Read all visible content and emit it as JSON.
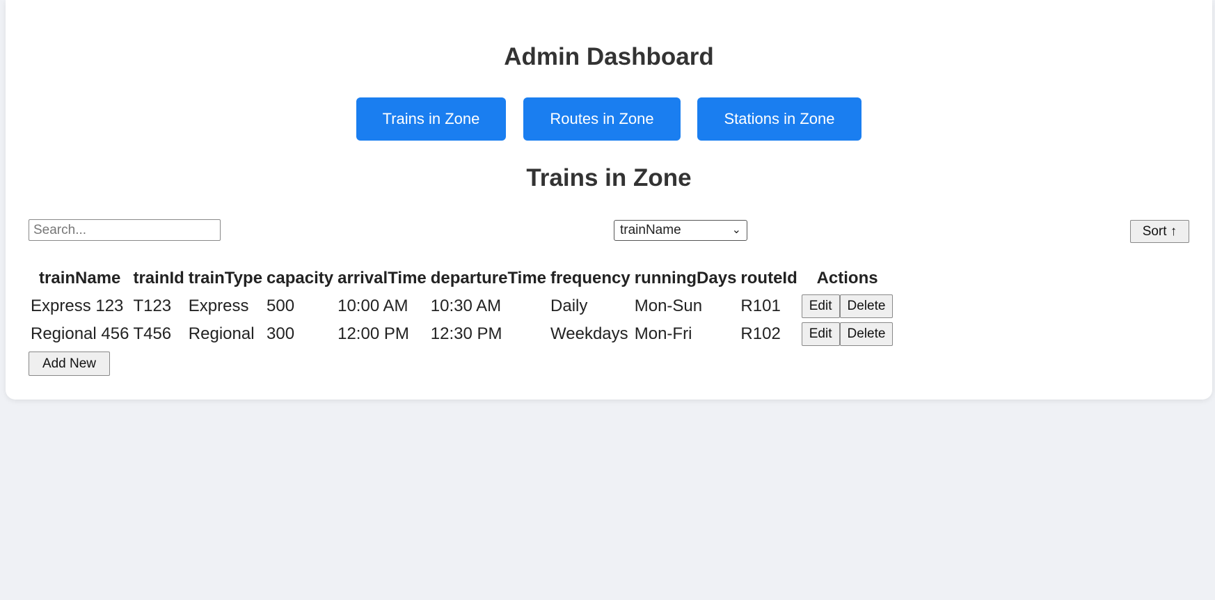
{
  "header": {
    "title": "Admin Dashboard"
  },
  "nav": {
    "buttons": [
      {
        "label": "Trains in Zone"
      },
      {
        "label": "Routes in Zone"
      },
      {
        "label": "Stations in Zone"
      }
    ],
    "accent_color": "#1a7ef0"
  },
  "section": {
    "title": "Trains in Zone"
  },
  "toolbar": {
    "search_placeholder": "Search...",
    "sort_field_selected": "trainName",
    "sort_button_label": "Sort ↑"
  },
  "table": {
    "columns": [
      "trainName",
      "trainId",
      "trainType",
      "capacity",
      "arrivalTime",
      "departureTime",
      "frequency",
      "runningDays",
      "routeId",
      "Actions"
    ],
    "rows": [
      {
        "trainName": "Express 123",
        "trainId": "T123",
        "trainType": "Express",
        "capacity": "500",
        "arrivalTime": "10:00 AM",
        "departureTime": "10:30 AM",
        "frequency": "Daily",
        "runningDays": "Mon-Sun",
        "routeId": "R101"
      },
      {
        "trainName": "Regional 456",
        "trainId": "T456",
        "trainType": "Regional",
        "capacity": "300",
        "arrivalTime": "12:00 PM",
        "departureTime": "12:30 PM",
        "frequency": "Weekdays",
        "runningDays": "Mon-Fri",
        "routeId": "R102"
      }
    ],
    "edit_label": "Edit",
    "delete_label": "Delete"
  },
  "add_new_label": "Add New"
}
